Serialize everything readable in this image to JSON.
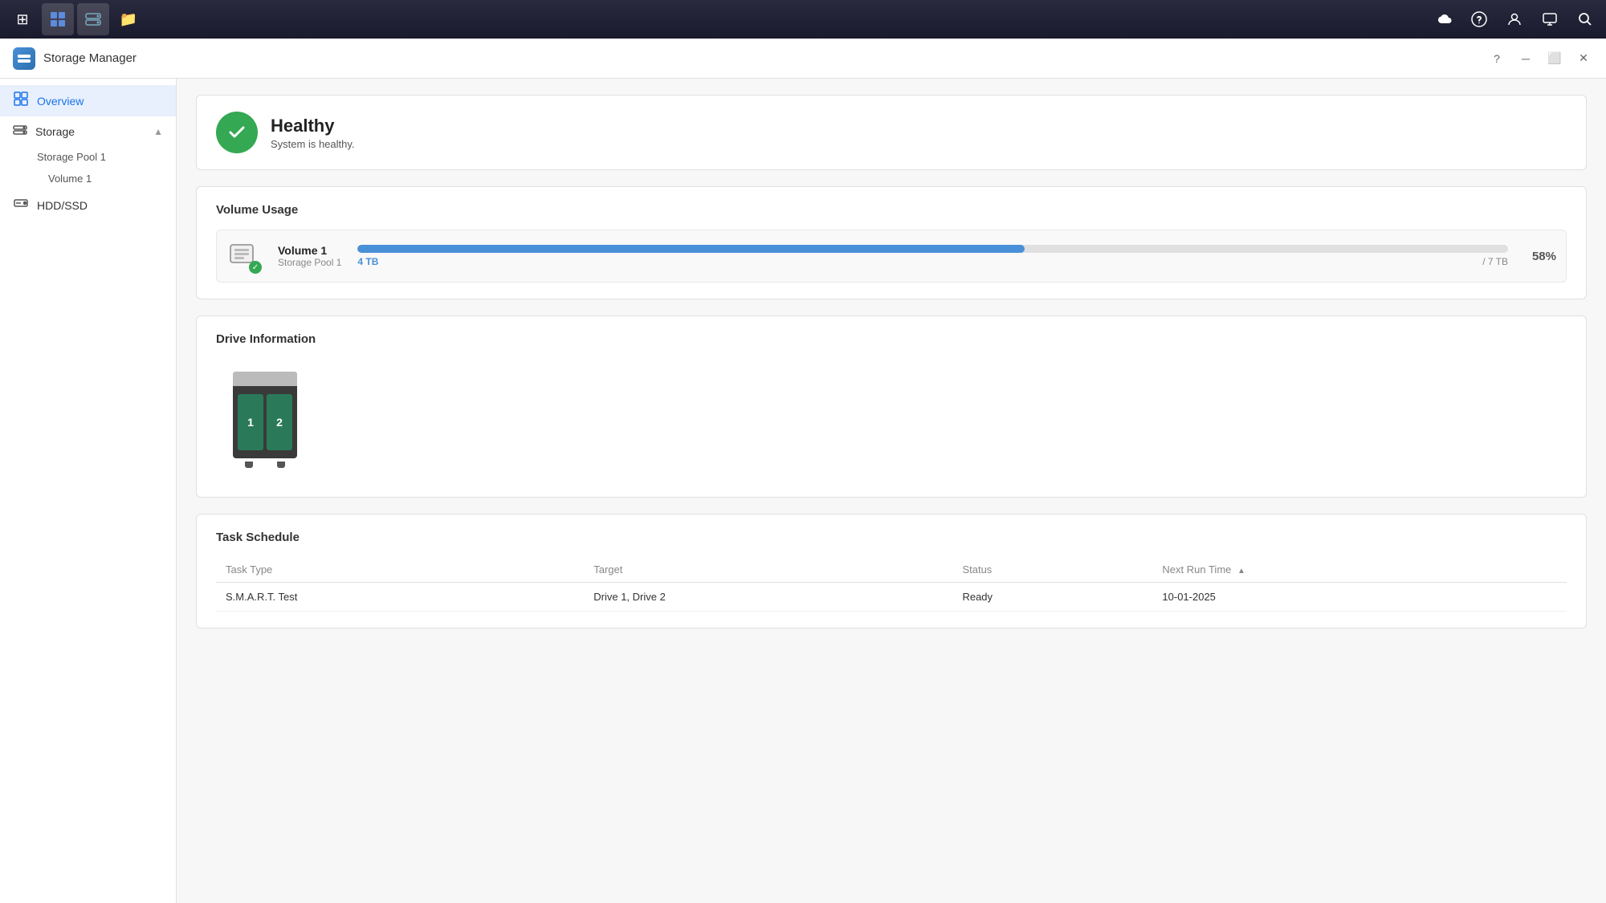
{
  "taskbar": {
    "apps": [
      {
        "name": "app-grid",
        "icon": "⊞",
        "active": false
      },
      {
        "name": "app-files",
        "icon": "▦",
        "active": false
      },
      {
        "name": "app-storage",
        "icon": "▤",
        "active": true
      },
      {
        "name": "app-folder",
        "icon": "📁",
        "active": false
      }
    ],
    "right_icons": [
      {
        "name": "cloud-icon",
        "icon": "☁"
      },
      {
        "name": "user-icon",
        "icon": "😊"
      },
      {
        "name": "person-icon",
        "icon": "👤"
      },
      {
        "name": "display-icon",
        "icon": "▦"
      },
      {
        "name": "search-icon",
        "icon": "🔍"
      }
    ]
  },
  "title_bar": {
    "logo_icon": "💾",
    "title": "Storage Manager",
    "controls": {
      "help": "?",
      "minimize": "─",
      "maximize": "⬜",
      "close": "✕"
    }
  },
  "sidebar": {
    "overview_label": "Overview",
    "storage_label": "Storage",
    "storage_pool_1_label": "Storage Pool 1",
    "volume_1_label": "Volume 1",
    "hdd_ssd_label": "HDD/SSD"
  },
  "content": {
    "health": {
      "status": "Healthy",
      "description": "System is healthy."
    },
    "volume_usage": {
      "section_title": "Volume Usage",
      "volume_name": "Volume 1",
      "pool_name": "Storage Pool 1",
      "used": "4 TB",
      "total": "7 TB",
      "separator": "/ 7 TB",
      "percent": "58%",
      "fill_percent": 58
    },
    "drive_information": {
      "section_title": "Drive Information",
      "bay1_label": "1",
      "bay2_label": "2"
    },
    "task_schedule": {
      "section_title": "Task Schedule",
      "columns": [
        {
          "key": "task_type",
          "label": "Task Type",
          "sortable": false
        },
        {
          "key": "target",
          "label": "Target",
          "sortable": false
        },
        {
          "key": "status",
          "label": "Status",
          "sortable": false
        },
        {
          "key": "next_run_time",
          "label": "Next Run Time",
          "sortable": true,
          "sort_dir": "asc"
        }
      ],
      "rows": [
        {
          "task_type": "S.M.A.R.T. Test",
          "target": "Drive 1, Drive 2",
          "status": "Ready",
          "next_run_time": "10-01-2025"
        }
      ]
    }
  }
}
